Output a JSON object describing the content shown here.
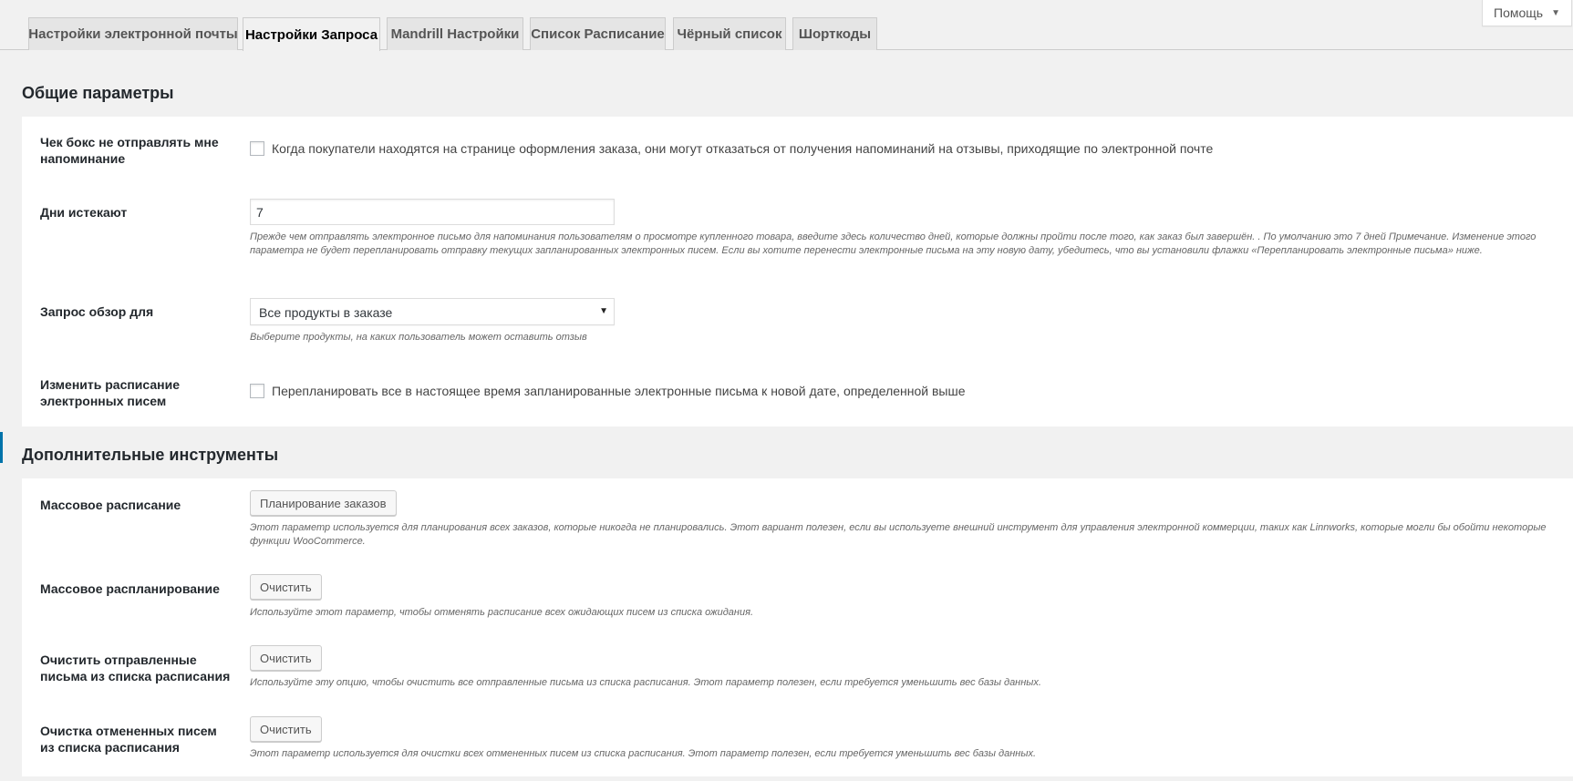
{
  "help": {
    "label": "Помощь"
  },
  "tabs": [
    {
      "label": "Настройки электронной почты",
      "active": false
    },
    {
      "label": "Настройки Запроса",
      "active": true
    },
    {
      "label": "Mandrill Настройки",
      "active": false
    },
    {
      "label": "Список Расписание",
      "active": false
    },
    {
      "label": "Чёрный список",
      "active": false
    },
    {
      "label": "Шорткоды",
      "active": false
    }
  ],
  "general": {
    "title": "Общие параметры",
    "opt_out": {
      "label": "Чек бокс не отправлять мне напоминание",
      "checkbox_text": "Когда покупатели находятся на странице оформления заказа, они могут отказаться от получения напоминаний на отзывы, приходящие по электронной почте",
      "checked": false
    },
    "days": {
      "label": "Дни истекают",
      "value": "7",
      "desc": "Прежде чем отправлять электронное письмо для напоминания пользователям о просмотре купленного товара, введите здесь количество дней, которые должны пройти после того, как заказ был завершён. . По умолчанию это 7 дней Примечание. Изменение этого параметра не будет перепланировать отправку текущих запланированных электронных писем. Если вы хотите перенести электронные письма на эту новую дату, убедитесь, что вы установили флажки «Перепланировать электронные письма» ниже."
    },
    "review_for": {
      "label": "Запрос обзор для",
      "selected": "Все продукты в заказе",
      "desc": "Выберите продукты, на каких пользователь может оставить отзыв"
    },
    "reschedule": {
      "label": "Изменить расписание электронных писем",
      "checkbox_text": "Перепланировать все в настоящее время запланированные электронные письма к новой дате, определенной выше",
      "checked": false
    }
  },
  "tools": {
    "title": "Дополнительные инструменты",
    "bulk_schedule": {
      "label": "Массовое расписание",
      "button": "Планирование заказов",
      "desc": "Этот параметр используется для планирования всех заказов, которые никогда не планировались. Этот вариант полезен, если вы используете внешний инструмент для управления электронной коммерции, таких как Linnworks, которые могли бы обойти некоторые функции WooCommerce."
    },
    "bulk_unschedule": {
      "label": "Массовое распланирование",
      "button": "Очистить",
      "desc": "Используйте этот параметр, чтобы отменять расписание всех ожидающих писем из списка ожидания."
    },
    "clear_sent": {
      "label": "Очистить отправленные письма из списка расписания",
      "button": "Очистить",
      "desc": "Используйте эту опцию, чтобы очистить все отправленные письма из списка расписания. Этот параметр полезен, если требуется уменьшить вес базы данных."
    },
    "clear_cancelled": {
      "label": "Очистка отмененных писем из списка расписания",
      "button": "Очистить",
      "desc": "Этот параметр используется для очистки всех отмененных писем из списка расписания. Этот параметр полезен, если требуется уменьшить вес базы данных."
    }
  }
}
